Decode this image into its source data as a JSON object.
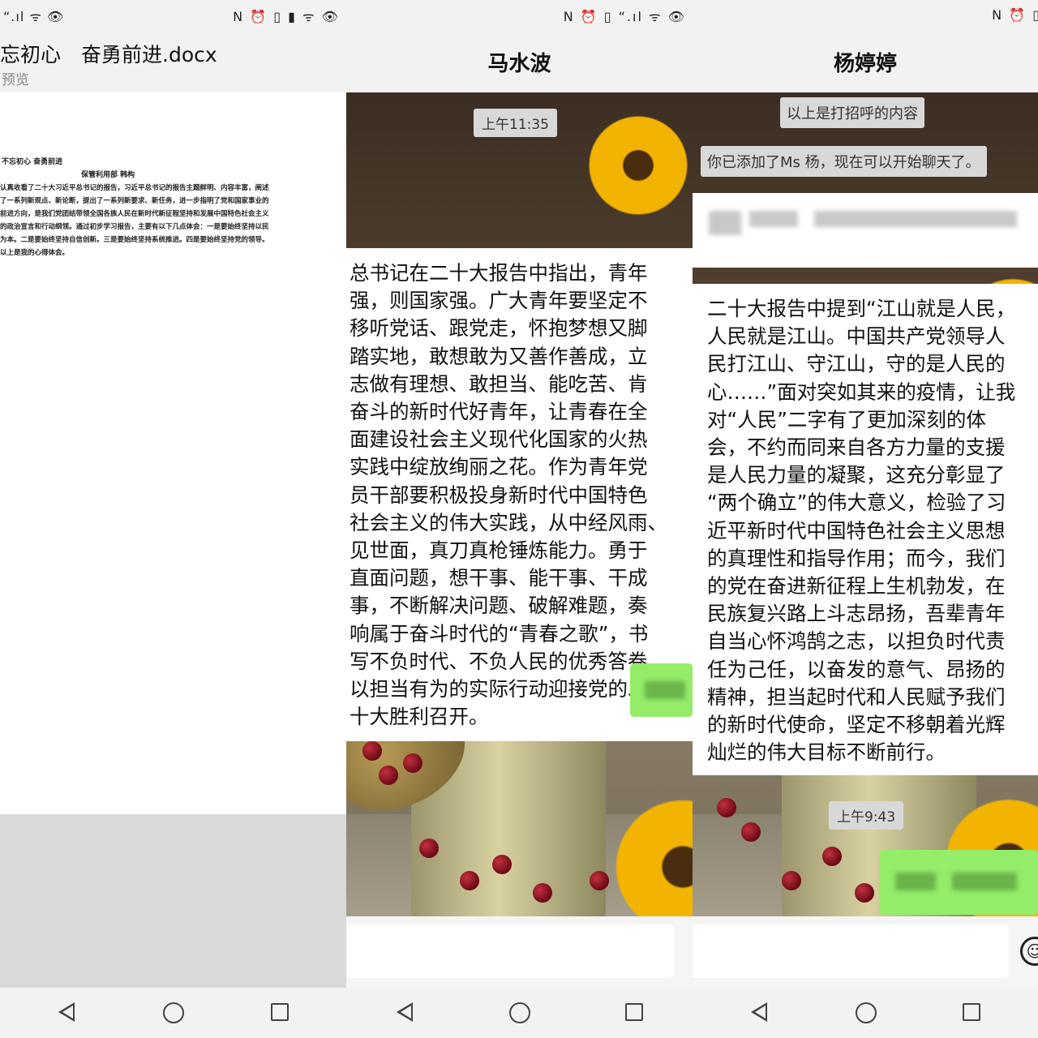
{
  "status_bar": {
    "left_icons": "“.ıl ᯤ 👁",
    "right_icons": "N ⏰ ▯ ▮ ᯤ 👁",
    "right_icons_2": "N ⏰ ▯ “.ıl ᯤ 👁",
    "right_icons_3": "N ⏰ ▯"
  },
  "doc_panel": {
    "title": "忘初心　奋勇前进.docx",
    "subtitle": "预览",
    "doc_heading": "不忘初心  奋勇前进",
    "doc_byline": "保管利用部    韩构",
    "doc_lines": [
      "认真收看了二十大习近平总书记的报告，习近平总书记的报告主题鲜明、内容丰富，阐述",
      "了一系列新观点、新论断，提出了一系列新要求、新任务，进一步指明了党和国家事业的",
      "前进方向，是我们党团结带领全国各族人民在新时代新征程坚持和发展中国特色社会主义",
      "的政治宣言和行动纲领。通过初步学习报告，主要有以下几点体会：一是要始终坚持以民",
      "为本。二是要始终坚持自信创新。三是要始终坚持系统推进。四是要始终坚持党的领导。",
      "以上是我的心得体会。"
    ]
  },
  "chat_ma": {
    "title": "马水波",
    "time": "上午11:35",
    "message_lines": [
      "总书记在二十大报告中指出，青年",
      "强，则国家强。广大青年要坚定不",
      "移听党话、跟党走，怀抱梦想又脚",
      "踏实地，敢想敢为又善作善成，立",
      "志做有理想、敢担当、能吃苦、肯",
      "奋斗的新时代好青年，让青春在全",
      "面建设社会主义现代化国家的火热",
      "实践中绽放绚丽之花。作为青年党",
      "员干部要积极投身新时代中国特色",
      "社会主义的伟大实践，从中经风雨、",
      "见世面，真刀真枪锤炼能力。勇于",
      "直面问题，想干事、能干事、干成",
      "事，不断解决问题、破解难题，奏",
      "响属于奋斗时代的“青春之歌”，书",
      "写不负时代、不负人民的优秀答卷，",
      "以担当有为的实际行动迎接党的二",
      "十大胜利召开。"
    ]
  },
  "chat_yang": {
    "title": "杨婷婷",
    "system_msg_1": "以上是打招呼的内容",
    "system_msg_2": "你已添加了Ms 杨，现在可以开始聊天了。",
    "time": "上午9:43",
    "message_lines": [
      "二十大报告中提到“江山就是人民，",
      "人民就是江山。中国共产党领导人",
      "民打江山、守江山，守的是人民的",
      "心……”面对突如其来的疫情，让我",
      "对“人民”二字有了更加深刻的体",
      "会，不约而同来自各方力量的支援",
      "是人民力量的凝聚，这充分彰显了",
      "“两个确立”的伟大意义，检验了习",
      "近平新时代中国特色社会主义思想",
      "的真理性和指导作用；而今，我们",
      "的党在奋进新征程上生机勃发，在",
      "民族复兴路上斗志昂扬，吾辈青年",
      "自当心怀鸿鹄之志，以担负时代责",
      "任为己任，以奋发的意气、昂扬的",
      "精神，担当起时代和人民赋予我们",
      "的新时代使命，坚定不移朝着光辉",
      "灿烂的伟大目标不断前行。"
    ]
  }
}
